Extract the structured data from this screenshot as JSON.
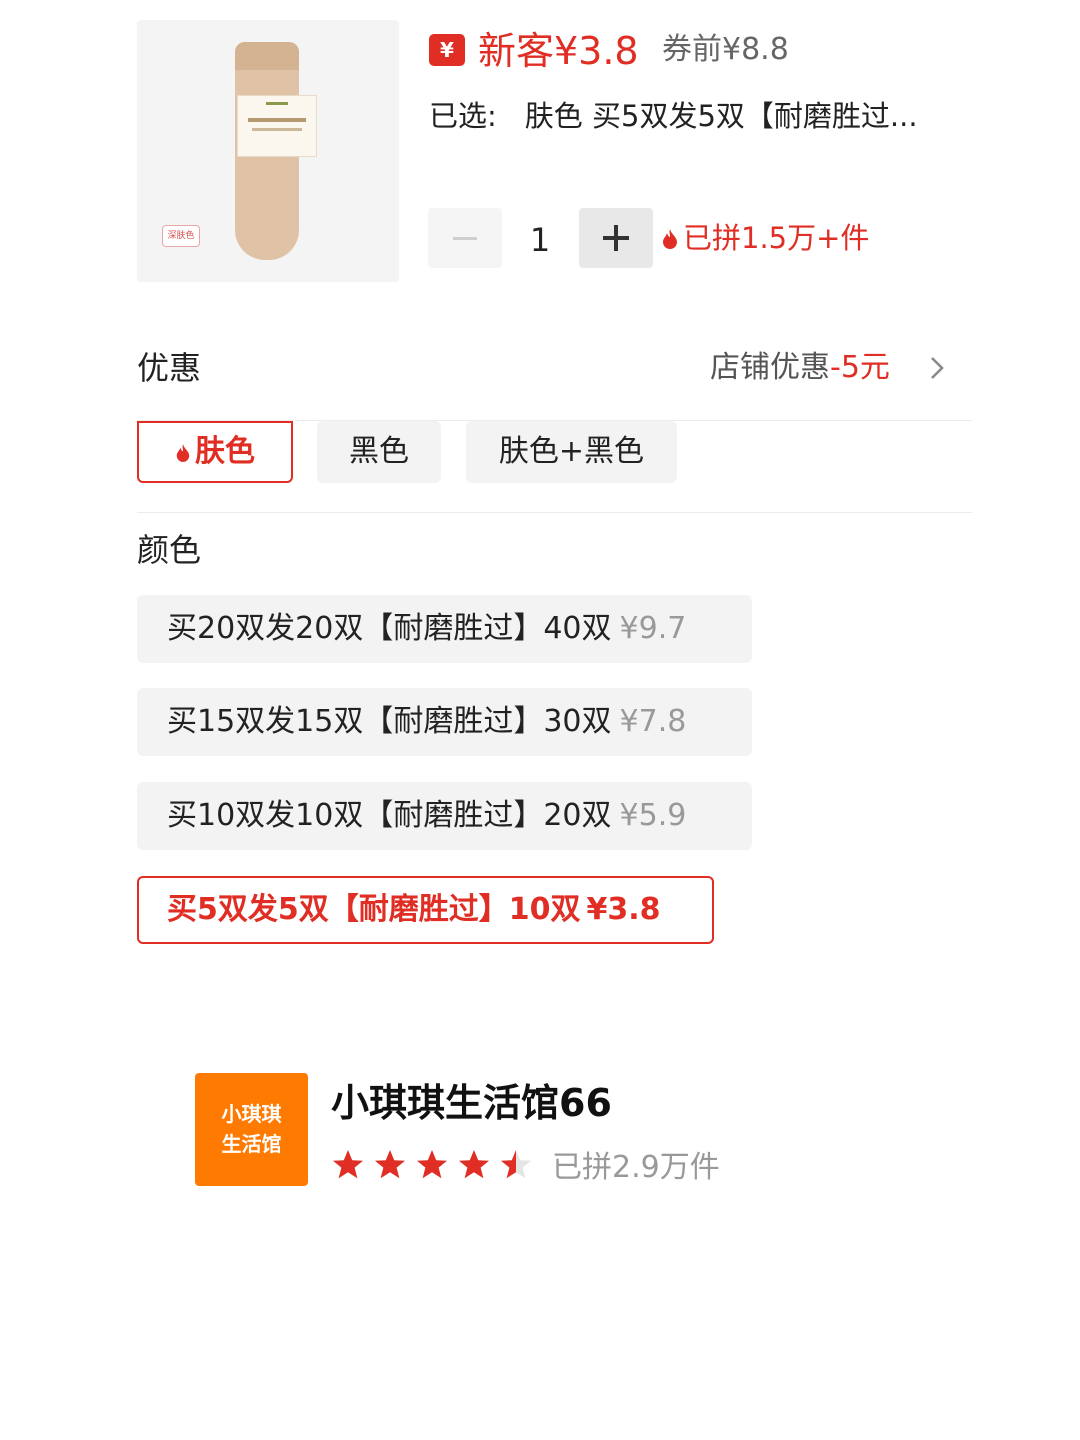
{
  "product": {
    "image_icon": "sock-product-image",
    "image_tag": "深肤色",
    "price_badge": "¥",
    "price_label": "新客¥3.8",
    "original_price": "券前¥8.8",
    "selected_label": "已选:",
    "selected_value": "肤色 买5双发5双【耐磨胜过...",
    "quantity": "1",
    "sold_text": "已拼1.5万+件"
  },
  "discount": {
    "title": "优惠",
    "label": "店铺优惠",
    "amount": "-5元"
  },
  "color_chips": [
    {
      "label": "肤色",
      "selected": true
    },
    {
      "label": "黑色",
      "selected": false
    },
    {
      "label": "肤色+黑色",
      "selected": false
    }
  ],
  "color_section_title": "颜色",
  "options": [
    {
      "label": "买20双发20双【耐磨胜过】40双",
      "price": "¥9.7",
      "selected": false
    },
    {
      "label": "买15双发15双【耐磨胜过】30双",
      "price": "¥7.8",
      "selected": false
    },
    {
      "label": "买10双发10双【耐磨胜过】20双",
      "price": "¥5.9",
      "selected": false
    },
    {
      "label": "买5双发5双【耐磨胜过】10双",
      "price": "¥3.8",
      "selected": true
    }
  ],
  "shop": {
    "logo_line1": "小琪琪",
    "logo_line2": "生活馆",
    "name": "小琪琪生活馆66",
    "rating": 4.5,
    "sold_text": "已拼2.9万件"
  },
  "colors": {
    "accent": "#e02e24",
    "shop_logo": "#ff7a00",
    "muted_text": "#999999"
  }
}
